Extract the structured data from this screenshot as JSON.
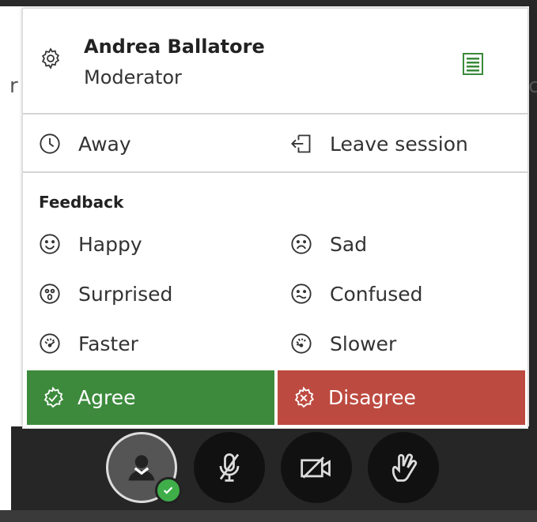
{
  "user": {
    "name": "Andrea Ballatore",
    "role": "Moderator"
  },
  "session": {
    "away_label": "Away",
    "leave_label": "Leave session"
  },
  "feedback": {
    "heading": "Feedback",
    "items": [
      {
        "label": "Happy",
        "icon": "happy-face-icon"
      },
      {
        "label": "Sad",
        "icon": "sad-face-icon"
      },
      {
        "label": "Surprised",
        "icon": "surprised-face-icon"
      },
      {
        "label": "Confused",
        "icon": "confused-face-icon"
      },
      {
        "label": "Faster",
        "icon": "faster-icon"
      },
      {
        "label": "Slower",
        "icon": "slower-icon"
      }
    ],
    "agree_label": "Agree",
    "disagree_label": "Disagree"
  },
  "background": {
    "left_fragment": "r",
    "right_fragment": "c"
  },
  "colors": {
    "agree": "#3d8a3d",
    "disagree": "#bd4a40",
    "list_icon": "#3a8a3a",
    "status_check": "#3fae49"
  }
}
